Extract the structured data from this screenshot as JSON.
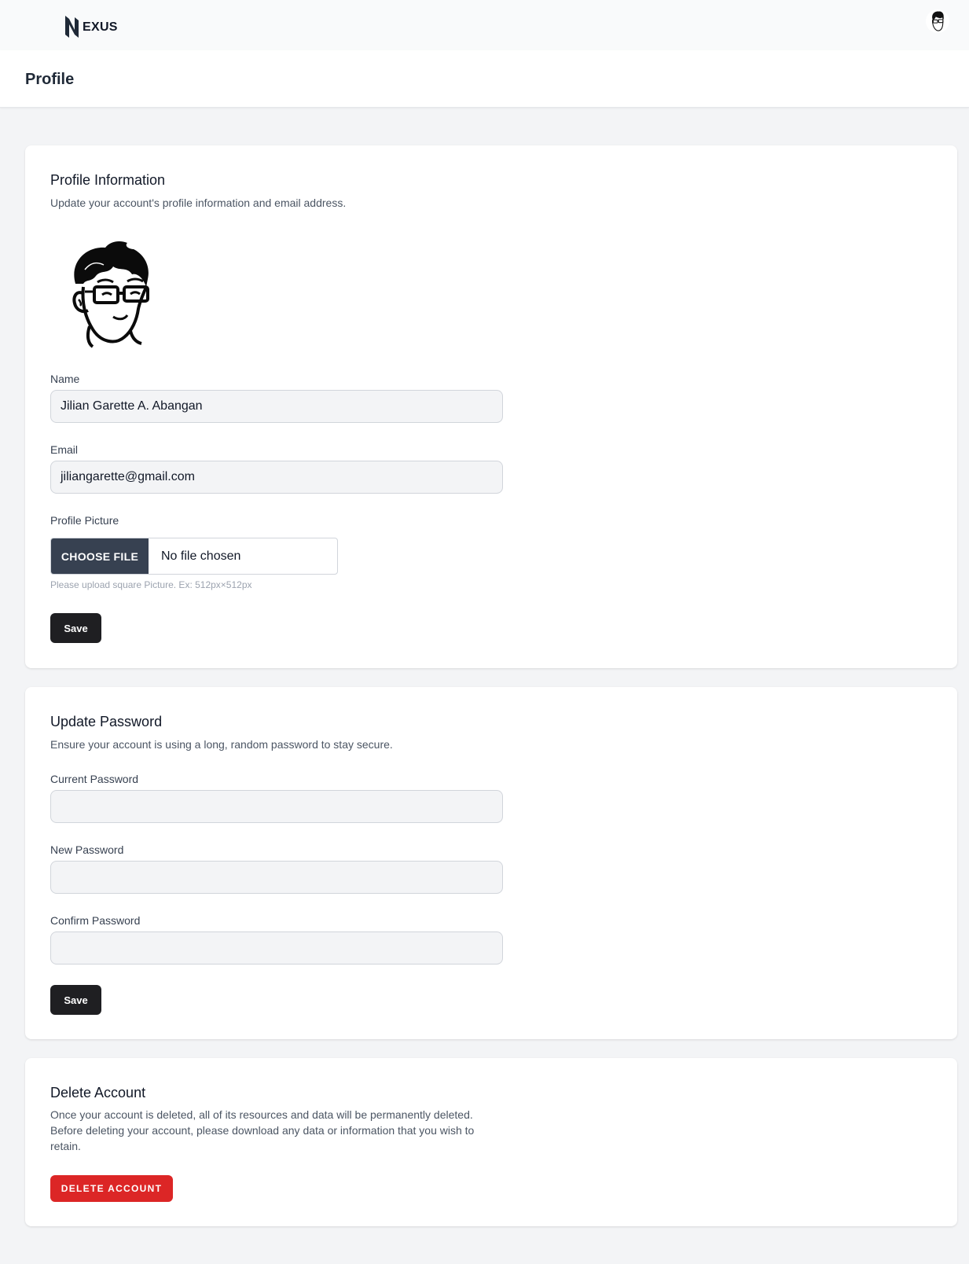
{
  "nav": {
    "logo_text": "EXUS",
    "avatar_icon": "user-avatar-icon"
  },
  "header": {
    "title": "Profile"
  },
  "profile_info": {
    "title": "Profile Information",
    "description": "Update your account's profile information and email address.",
    "avatar_icon": "user-avatar-icon",
    "name_label": "Name",
    "name_value": "Jilian Garette A. Abangan",
    "email_label": "Email",
    "email_value": "jiliangarette@gmail.com",
    "picture_label": "Profile Picture",
    "choose_file_label": "CHOOSE FILE",
    "file_status": "No file chosen",
    "picture_hint": "Please upload square Picture. Ex: 512px×512px",
    "save_label": "Save"
  },
  "update_password": {
    "title": "Update Password",
    "description": "Ensure your account is using a long, random password to stay secure.",
    "current_label": "Current Password",
    "current_value": "",
    "new_label": "New Password",
    "new_value": "",
    "confirm_label": "Confirm Password",
    "confirm_value": "",
    "save_label": "Save"
  },
  "delete_account": {
    "title": "Delete Account",
    "description": "Once your account is deleted, all of its resources and data will be permanently deleted. Before deleting your account, please download any data or information that you wish to retain.",
    "button_label": "DELETE ACCOUNT"
  },
  "colors": {
    "danger": "#dc2626",
    "primary_button": "#1f1f22",
    "file_button": "#374151",
    "background": "#f3f4f6"
  }
}
